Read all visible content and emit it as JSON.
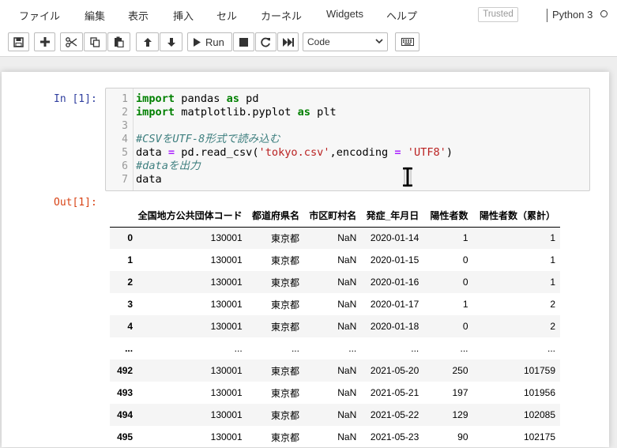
{
  "menubar": {
    "items": [
      "ファイル",
      "編集",
      "表示",
      "挿入",
      "セル",
      "カーネル",
      "Widgets",
      "ヘルプ"
    ],
    "trusted": "Trusted",
    "kernel_name": "Python 3"
  },
  "toolbar": {
    "buttons": [
      {
        "icon": "save-icon"
      },
      {
        "icon": "plus-icon"
      },
      {
        "icon": "cut-icon"
      },
      {
        "icon": "copy-icon"
      },
      {
        "icon": "paste-icon"
      },
      {
        "icon": "arrow-up-icon"
      },
      {
        "icon": "arrow-down-icon"
      },
      {
        "icon": "play-icon",
        "label": "Run"
      },
      {
        "icon": "stop-icon"
      },
      {
        "icon": "restart-icon"
      },
      {
        "icon": "fast-forward-icon"
      },
      {
        "icon": "keyboard-icon"
      }
    ],
    "run_label": "Run",
    "cell_type": "Code"
  },
  "cell": {
    "in_prompt": "In [1]:",
    "out_prompt": "Out[1]:",
    "line_numbers": [
      "1",
      "2",
      "3",
      "4",
      "5",
      "6",
      "7"
    ],
    "code_lines": [
      "import pandas as pd",
      "import matplotlib.pyplot as plt",
      "",
      "#CSVをUTF-8形式で読み込む",
      "data = pd.read_csv('tokyo.csv',encoding = 'UTF8')",
      "#dataを出力",
      "data"
    ]
  },
  "dataframe": {
    "columns": [
      "",
      "全国地方公共団体コード",
      "都道府県名",
      "市区町村名",
      "発症_年月日",
      "陽性者数",
      "陽性者数（累計）"
    ],
    "rows": [
      [
        "0",
        "130001",
        "東京都",
        "NaN",
        "2020-01-14",
        "1",
        "1"
      ],
      [
        "1",
        "130001",
        "東京都",
        "NaN",
        "2020-01-15",
        "0",
        "1"
      ],
      [
        "2",
        "130001",
        "東京都",
        "NaN",
        "2020-01-16",
        "0",
        "1"
      ],
      [
        "3",
        "130001",
        "東京都",
        "NaN",
        "2020-01-17",
        "1",
        "2"
      ],
      [
        "4",
        "130001",
        "東京都",
        "NaN",
        "2020-01-18",
        "0",
        "2"
      ],
      [
        "...",
        "...",
        "...",
        "...",
        "...",
        "...",
        "..."
      ],
      [
        "492",
        "130001",
        "東京都",
        "NaN",
        "2021-05-20",
        "250",
        "101759"
      ],
      [
        "493",
        "130001",
        "東京都",
        "NaN",
        "2021-05-21",
        "197",
        "101956"
      ],
      [
        "494",
        "130001",
        "東京都",
        "NaN",
        "2021-05-22",
        "129",
        "102085"
      ],
      [
        "495",
        "130001",
        "東京都",
        "NaN",
        "2021-05-23",
        "90",
        "102175"
      ]
    ]
  },
  "colors": {
    "in_prompt": "#303f9f",
    "out_prompt": "#d84315",
    "keyword": "#008000",
    "operator": "#aa22ff",
    "string": "#ba2121",
    "comment": "#408080"
  }
}
